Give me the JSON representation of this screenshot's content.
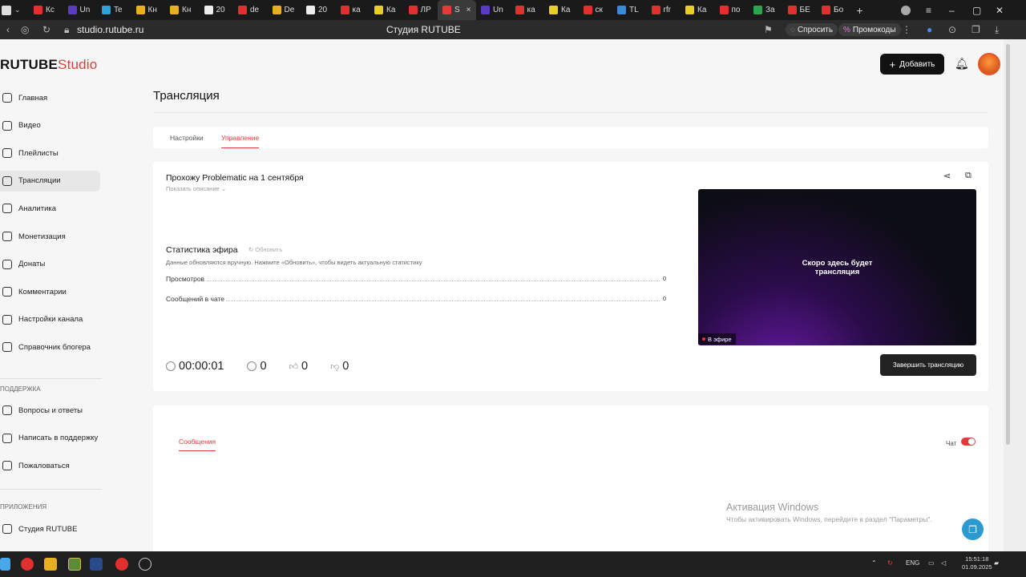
{
  "browser": {
    "tabs": [
      {
        "label": "Кс",
        "color": "#e03030"
      },
      {
        "label": "Un",
        "color": "#5a3cc4"
      },
      {
        "label": "Te",
        "color": "#2aa3d8"
      },
      {
        "label": "Кн",
        "color": "#e8b020"
      },
      {
        "label": "Кн",
        "color": "#e8b020"
      },
      {
        "label": "20",
        "color": "#eeeeee"
      },
      {
        "label": "de",
        "color": "#e03030"
      },
      {
        "label": "De",
        "color": "#e8b020"
      },
      {
        "label": "20",
        "color": "#eeeeee"
      },
      {
        "label": "ка",
        "color": "#e03030"
      },
      {
        "label": "Ка",
        "color": "#e8d020"
      },
      {
        "label": "ЛР",
        "color": "#e03030"
      },
      {
        "label": "S",
        "color": "#e33b3b",
        "active": true
      },
      {
        "label": "Un",
        "color": "#5a3cc4"
      },
      {
        "label": "ка",
        "color": "#e03030"
      },
      {
        "label": "Ка",
        "color": "#e8d020"
      },
      {
        "label": "ск",
        "color": "#e03030"
      },
      {
        "label": "TL",
        "color": "#3a8ad8"
      },
      {
        "label": "rfr",
        "color": "#e03030"
      },
      {
        "label": "Ка",
        "color": "#e8d020"
      },
      {
        "label": "по",
        "color": "#e03030"
      },
      {
        "label": "За",
        "color": "#2ea44f"
      },
      {
        "label": "БЕ",
        "color": "#e03030"
      },
      {
        "label": "Бо",
        "color": "#e03030"
      }
    ],
    "new_tab": "+",
    "url": "studio.rutube.ru",
    "page_title": "Студия RUTUBE",
    "ask_label": "Спросить",
    "promo_label": "Промокоды"
  },
  "header": {
    "logo_main": "RUTUBE",
    "logo_studio": "Studio",
    "add_label": "Добавить"
  },
  "sidebar": {
    "items": [
      {
        "label": "Главная",
        "icon": "home-icon"
      },
      {
        "label": "Видео",
        "icon": "video-icon"
      },
      {
        "label": "Плейлисты",
        "icon": "playlist-icon"
      },
      {
        "label": "Трансляции",
        "icon": "broadcast-icon",
        "active": true
      },
      {
        "label": "Аналитика",
        "icon": "analytics-icon"
      },
      {
        "label": "Монетизация",
        "icon": "monetization-icon"
      },
      {
        "label": "Донаты",
        "icon": "donate-icon"
      },
      {
        "label": "Комментарии",
        "icon": "comments-icon"
      },
      {
        "label": "Настройки канала",
        "icon": "settings-icon"
      },
      {
        "label": "Справочник блогера",
        "icon": "guide-icon"
      }
    ],
    "support_heading": "ПОДДЕРЖКА",
    "support_items": [
      {
        "label": "Вопросы и ответы",
        "icon": "faq-icon"
      },
      {
        "label": "Написать в поддержку",
        "icon": "mail-icon"
      },
      {
        "label": "Пожаловаться",
        "icon": "flag-icon"
      }
    ],
    "apps_heading": "ПРИЛОЖЕНИЯ",
    "apps_items": [
      {
        "label": "Студия RUTUBE",
        "icon": "studio-app-icon"
      }
    ]
  },
  "main": {
    "title": "Трансляция",
    "tabs": [
      {
        "label": "Настройки"
      },
      {
        "label": "Управление",
        "active": true
      }
    ],
    "stream": {
      "title": "Прохожу Problematic на 1 сентября",
      "show_description": "Показать описание",
      "stats_title": "Статистика эфира",
      "refresh_label": "Обновить",
      "stats_note": "Данные обновляются вручную. Нажмите «Обновить», чтобы видеть актуальную статистику",
      "stats": [
        {
          "label": "Просмотров",
          "value": "0"
        },
        {
          "label": "Сообщений в чате",
          "value": "0"
        }
      ],
      "timer": "00:00:01",
      "viewers": "0",
      "likes": "0",
      "dislikes": "0",
      "preview_text_1": "Скоро здесь будет",
      "preview_text_2": "трансляция",
      "live_badge": "В эфире",
      "end_button": "Завершить трансляцию"
    },
    "chat": {
      "messages_tab": "Сообщения",
      "chat_label": "Чат",
      "chat_enabled": true
    }
  },
  "watermark": {
    "line1": "Активация Windows",
    "line2": "Чтобы активировать Windows, перейдите в раздел \"Параметры\"."
  },
  "taskbar": {
    "lang": "ENG",
    "time": "15:51:18",
    "date": "01.09.2025"
  }
}
